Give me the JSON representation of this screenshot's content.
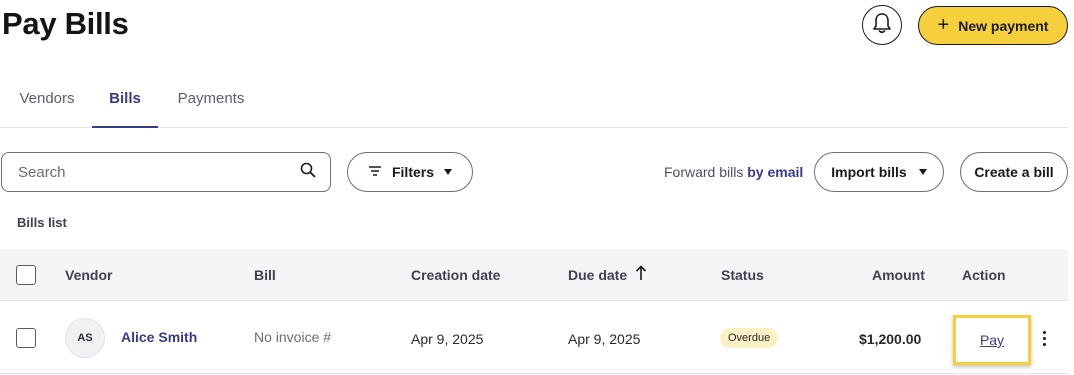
{
  "header": {
    "title": "Pay Bills",
    "bell_icon": "bell-icon",
    "new_payment_label": "New payment",
    "new_payment_icon": "plus-icon",
    "accent_color": "#f6cf3d"
  },
  "tabs": [
    {
      "label": "Vendors",
      "active": false
    },
    {
      "label": "Bills",
      "active": true
    },
    {
      "label": "Payments",
      "active": false
    }
  ],
  "toolbar": {
    "search_placeholder": "Search",
    "search_value": "",
    "filters_label": "Filters",
    "forward_prefix": "Forward bills",
    "forward_link": "by email",
    "import_label": "Import bills",
    "create_label": "Create a bill"
  },
  "list": {
    "title": "Bills list",
    "columns": {
      "vendor": "Vendor",
      "bill": "Bill",
      "creation_date": "Creation date",
      "due_date": "Due date",
      "due_date_sort_icon": "arrow-up-icon",
      "status": "Status",
      "amount": "Amount",
      "action": "Action"
    },
    "rows": [
      {
        "initials": "AS",
        "vendor": "Alice Smith",
        "bill": "No invoice #",
        "creation_date": "Apr 9, 2025",
        "due_date": "Apr 9, 2025",
        "status": "Overdue",
        "amount": "$1,200.00",
        "action": "Pay"
      }
    ]
  },
  "colors": {
    "brand_purple": "#3a3a8c",
    "overdue_badge": "#fbf1c4",
    "header_bg": "#f5f5f7"
  }
}
